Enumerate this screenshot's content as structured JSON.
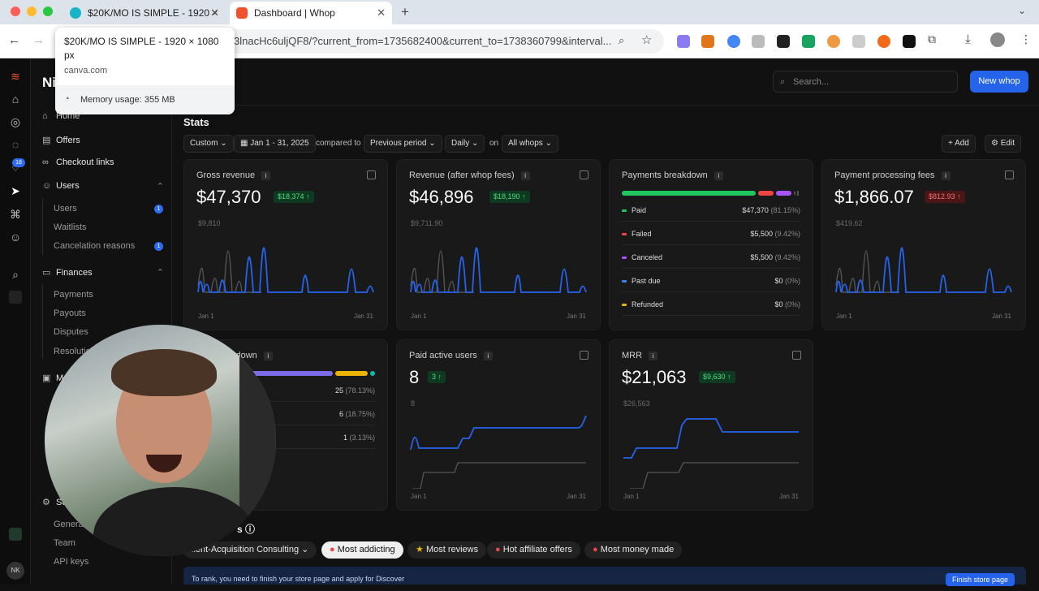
{
  "browser": {
    "tabs": [
      {
        "title": "$20K/MO IS SIMPLE - 1920 ×"
      },
      {
        "title": "Dashboard | Whop"
      }
    ],
    "new_tab": "+",
    "url": "3lnacHc6uljQF8/?current_from=1735682400&current_to=1738360799&interval...",
    "tooltip": {
      "title": "$20K/MO IS SIMPLE - 1920 × 1080 px",
      "domain": "canva.com",
      "memory": "Memory usage: 355 MB"
    }
  },
  "sidebar": {
    "brand_initials": "Ni",
    "items": [
      {
        "label": "Home",
        "icon": "home-icon"
      },
      {
        "label": "Offers",
        "icon": "offers-icon"
      },
      {
        "label": "Checkout links",
        "icon": "link-icon"
      },
      {
        "label": "Users",
        "icon": "users-icon"
      },
      {
        "label": "Finances",
        "icon": "finances-icon"
      }
    ],
    "users_sub": [
      {
        "label": "Users",
        "badge": "1"
      },
      {
        "label": "Waitlists",
        "badge": ""
      },
      {
        "label": "Cancelation reasons",
        "badge": "1"
      }
    ],
    "finances_sub": [
      "Payments",
      "Payouts",
      "Disputes",
      "Resolution"
    ],
    "more": [
      "Ma",
      "Se"
    ],
    "settings_sub": [
      "General",
      "Team",
      "API keys"
    ],
    "rail_badge": "18",
    "avatar_initials": "NK"
  },
  "topbar": {
    "search_placeholder": "Search...",
    "new_whop": "New whop"
  },
  "stats": {
    "title": "Stats",
    "filters": {
      "range": "Custom",
      "dates": "Jan 1 - 31, 2025",
      "compared": "compared to",
      "period": "Previous period",
      "interval": "Daily",
      "on": "on",
      "whops": "All whops"
    },
    "add": "Add",
    "edit": "Edit"
  },
  "cards": {
    "gross": {
      "title": "Gross revenue",
      "value": "$47,370",
      "delta": "$18,374 ↑",
      "ymax": "$9,810",
      "x0": "Jan 1",
      "x1": "Jan 31"
    },
    "revenue": {
      "title": "Revenue (after whop fees)",
      "value": "$46,896",
      "delta": "$18,190 ↑",
      "ymax": "$9,711.90",
      "x0": "Jan 1",
      "x1": "Jan 31"
    },
    "payments": {
      "title": "Payments breakdown",
      "rows": [
        {
          "label": "Paid",
          "amount": "$47,370",
          "pct": "(81.15%)",
          "color": "#22c55e"
        },
        {
          "label": "Failed",
          "amount": "$5,500",
          "pct": "(9.42%)",
          "color": "#ef4444"
        },
        {
          "label": "Canceled",
          "amount": "$5,500",
          "pct": "(9.42%)",
          "color": "#a855f7"
        },
        {
          "label": "Past due",
          "amount": "$0",
          "pct": "(0%)",
          "color": "#3b82f6"
        },
        {
          "label": "Refunded",
          "amount": "$0",
          "pct": "(0%)",
          "color": "#eab308"
        }
      ]
    },
    "fees": {
      "title": "Payment processing fees",
      "value": "$1,866.07",
      "delta": "$812.93 ↑",
      "ymax": "$419.62",
      "x0": "Jan 1",
      "x1": "Jan 31"
    },
    "users_breakdown": {
      "title": "kdown",
      "rows": [
        {
          "v": "25",
          "p": "(78.13%)"
        },
        {
          "v": "6",
          "p": "(18.75%)"
        },
        {
          "v": "1",
          "p": "(3.13%)"
        }
      ]
    },
    "paid_users": {
      "title": "Paid active users",
      "value": "8",
      "delta": "3 ↑",
      "ymax": "8",
      "x0": "Jan 1",
      "x1": "Jan 31"
    },
    "mrr": {
      "title": "MRR",
      "value": "$21,063",
      "delta": "$9,630 ↑",
      "ymax": "$26,563",
      "x0": "Jan 1",
      "x1": "Jan 31"
    }
  },
  "discover": {
    "heading": "s",
    "chips": [
      "lient-Acquisition Consulting",
      "Most addicting",
      "Most reviews",
      "Hot affiliate offers",
      "Most money made"
    ],
    "banner": "To rank, you need to finish your store page and apply for Discover",
    "finish": "Finish store page"
  },
  "colors": {
    "accent": "#2563eb",
    "line_current": "#2563eb",
    "line_previous": "#555555"
  }
}
